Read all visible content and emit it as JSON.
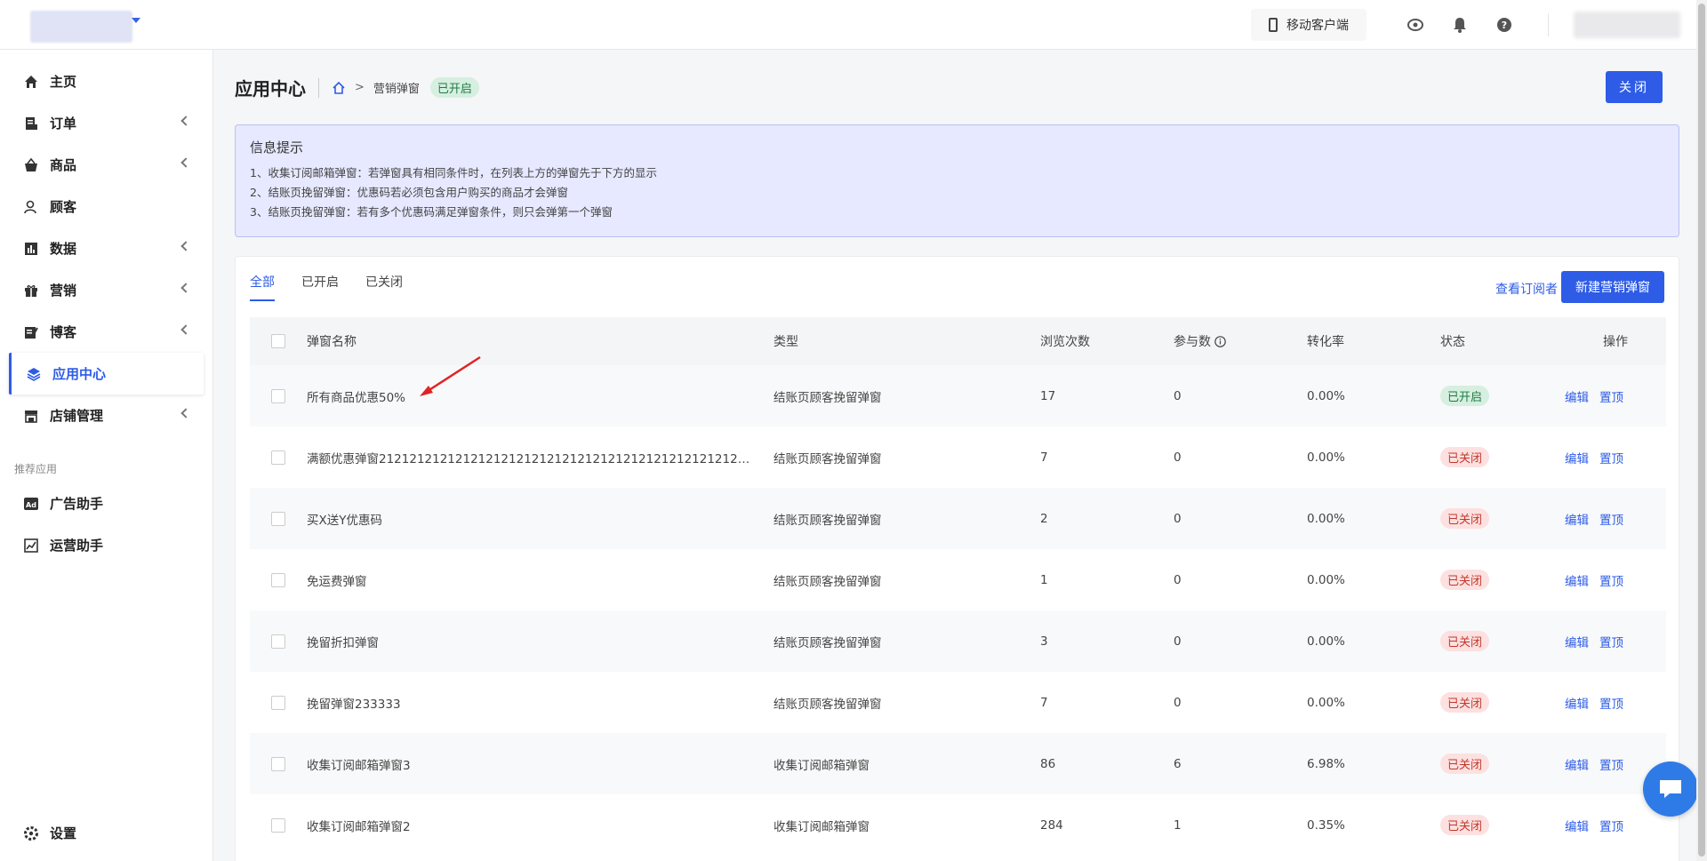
{
  "topbar": {
    "mobile_label": "移动客户端"
  },
  "sidebar": {
    "items": [
      {
        "label": "主页",
        "icon": "home-icon",
        "has_chevron": false
      },
      {
        "label": "订单",
        "icon": "order-icon",
        "has_chevron": true
      },
      {
        "label": "商品",
        "icon": "basket-icon",
        "has_chevron": true
      },
      {
        "label": "顾客",
        "icon": "user-icon",
        "has_chevron": false
      },
      {
        "label": "数据",
        "icon": "chart-icon",
        "has_chevron": true
      },
      {
        "label": "营销",
        "icon": "gift-icon",
        "has_chevron": true
      },
      {
        "label": "博客",
        "icon": "blog-icon",
        "has_chevron": true
      },
      {
        "label": "应用中心",
        "icon": "layers-icon",
        "has_chevron": false,
        "active": true
      },
      {
        "label": "店铺管理",
        "icon": "store-icon",
        "has_chevron": true
      }
    ],
    "section_label": "推荐应用",
    "recommended": [
      {
        "label": "广告助手",
        "icon": "ad-icon"
      },
      {
        "label": "运营助手",
        "icon": "trend-icon"
      }
    ],
    "settings_label": "设置"
  },
  "header": {
    "title": "应用中心",
    "breadcrumb": "营销弹窗",
    "status": "已开启",
    "close_label": "关闭"
  },
  "info": {
    "title": "信息提示",
    "lines": [
      "1、收集订阅邮箱弹窗：若弹窗具有相同条件时，在列表上方的弹窗先于下方的显示",
      "2、结账页挽留弹窗：优惠码若必须包含用户购买的商品才会弹窗",
      "3、结账页挽留弹窗：若有多个优惠码满足弹窗条件，则只会弹第一个弹窗"
    ]
  },
  "tabs": [
    "全部",
    "已开启",
    "已关闭"
  ],
  "actions": {
    "view_subscribers": "查看订阅者",
    "new_popup": "新建营销弹窗"
  },
  "table": {
    "headers": [
      "弹窗名称",
      "类型",
      "浏览次数",
      "参与数",
      "转化率",
      "状态",
      "操作"
    ],
    "rows": [
      {
        "name": "所有商品优惠50%",
        "type": "结账页顾客挽留弹窗",
        "views": "17",
        "participants": "0",
        "conversion": "0.00%",
        "status": "已开启",
        "status_key": "on"
      },
      {
        "name": "满额优惠弹窗2121212121212121212121212121212121212121212121212121...",
        "type": "结账页顾客挽留弹窗",
        "views": "7",
        "participants": "0",
        "conversion": "0.00%",
        "status": "已关闭",
        "status_key": "off"
      },
      {
        "name": "买X送Y优惠码",
        "type": "结账页顾客挽留弹窗",
        "views": "2",
        "participants": "0",
        "conversion": "0.00%",
        "status": "已关闭",
        "status_key": "off"
      },
      {
        "name": "免运费弹窗",
        "type": "结账页顾客挽留弹窗",
        "views": "1",
        "participants": "0",
        "conversion": "0.00%",
        "status": "已关闭",
        "status_key": "off"
      },
      {
        "name": "挽留折扣弹窗",
        "type": "结账页顾客挽留弹窗",
        "views": "3",
        "participants": "0",
        "conversion": "0.00%",
        "status": "已关闭",
        "status_key": "off"
      },
      {
        "name": "挽留弹窗233333",
        "type": "结账页顾客挽留弹窗",
        "views": "7",
        "participants": "0",
        "conversion": "0.00%",
        "status": "已关闭",
        "status_key": "off"
      },
      {
        "name": "收集订阅邮箱弹窗3",
        "type": "收集订阅邮箱弹窗",
        "views": "86",
        "participants": "6",
        "conversion": "6.98%",
        "status": "已关闭",
        "status_key": "off"
      },
      {
        "name": "收集订阅邮箱弹窗2",
        "type": "收集订阅邮箱弹窗",
        "views": "284",
        "participants": "1",
        "conversion": "0.35%",
        "status": "已关闭",
        "status_key": "off"
      }
    ],
    "edit_label": "编辑",
    "pin_label": "置顶"
  },
  "colors": {
    "accent": "#2e5ce6",
    "on_bg": "#d6efe0",
    "off_bg": "#fde0e0"
  }
}
